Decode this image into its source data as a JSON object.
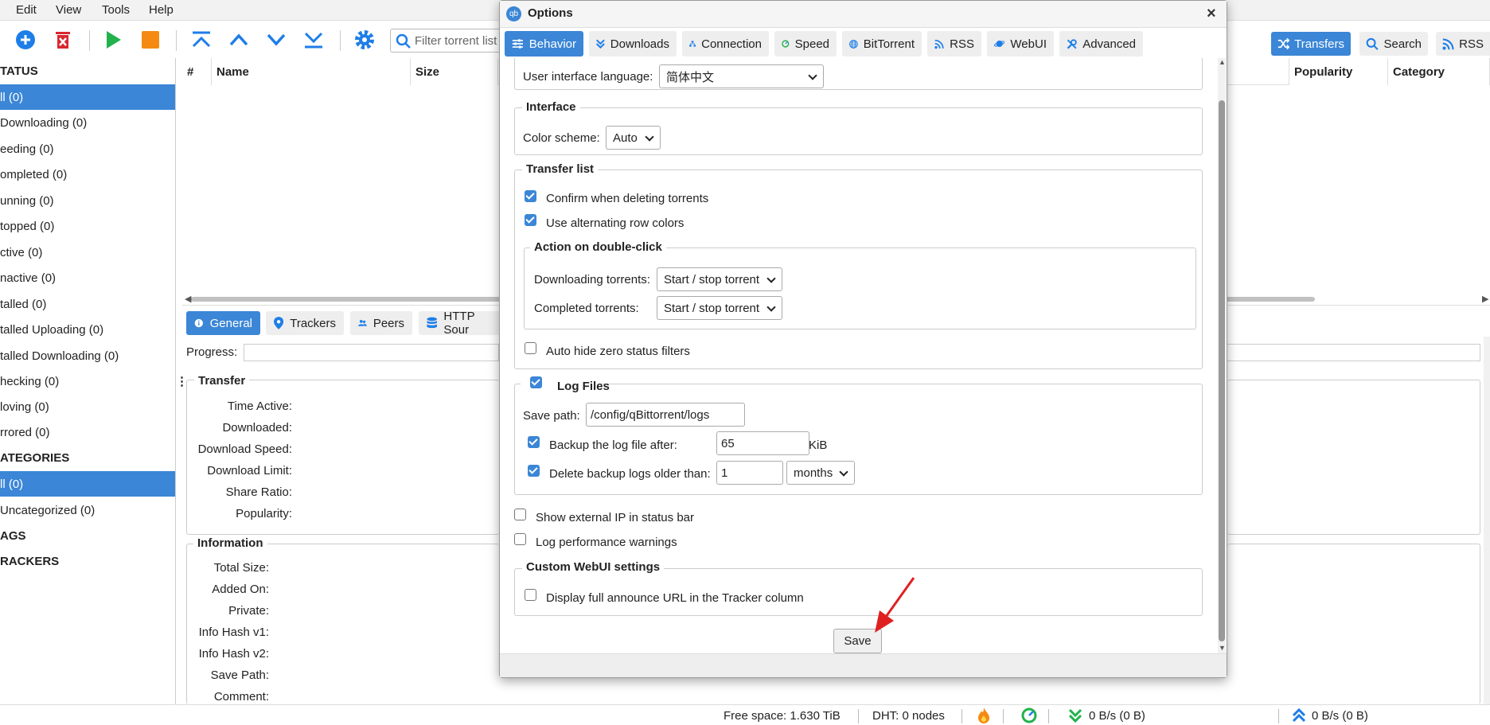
{
  "menu": {
    "items": [
      "Edit",
      "View",
      "Tools",
      "Help"
    ]
  },
  "toolbar": {
    "filter_placeholder": "Filter torrent list...",
    "filter_visible": "Filter torrent list",
    "right_tabs": [
      {
        "label": "Transfers",
        "icon": "shuffle-icon",
        "active": true
      },
      {
        "label": "Search",
        "icon": "search-icon",
        "active": false
      },
      {
        "label": "RSS",
        "icon": "rss-icon",
        "active": false
      }
    ]
  },
  "sidebar": {
    "status_header": "TATUS",
    "status_items": [
      "ll (0)",
      "Downloading (0)",
      "eeding (0)",
      "ompleted (0)",
      "unning (0)",
      "topped (0)",
      "ctive (0)",
      "nactive (0)",
      "talled (0)",
      "talled Uploading (0)",
      "talled Downloading (0)",
      "hecking (0)",
      "loving (0)",
      "rrored (0)"
    ],
    "categories_header": "ATEGORIES",
    "category_items": [
      "ll (0)",
      "Uncategorized (0)"
    ],
    "tags_header": "AGS",
    "trackers_header": "RACKERS"
  },
  "table": {
    "columns_left": [
      "#",
      "Name",
      "Size"
    ],
    "columns_right": [
      "Popularity",
      "Category"
    ]
  },
  "panel": {
    "tabs": [
      {
        "label": "General",
        "icon": "info-icon",
        "active": true
      },
      {
        "label": "Trackers",
        "icon": "location-pin-icon",
        "active": false
      },
      {
        "label": "Peers",
        "icon": "users-icon",
        "active": false
      },
      {
        "label": "HTTP Sour",
        "icon": "database-icon",
        "active": false
      }
    ],
    "progress_label": "Progress:",
    "transfer_legend": "Transfer",
    "transfer_fields": [
      "Time Active:",
      "Downloaded:",
      "Download Speed:",
      "Download Limit:",
      "Share Ratio:",
      "Popularity:"
    ],
    "information_legend": "Information",
    "information_fields": [
      "Total Size:",
      "Added On:",
      "Private:",
      "Info Hash v1:",
      "Info Hash v2:",
      "Save Path:",
      "Comment:"
    ]
  },
  "statusbar": {
    "free_space": "Free space: 1.630 TiB",
    "dht": "DHT: 0 nodes",
    "download": "0 B/s (0 B)",
    "upload": "0 B/s (0 B)"
  },
  "dialog": {
    "title": "Options",
    "app_icon_text": "qb",
    "close_glyph": "×",
    "tabs": [
      {
        "label": "Behavior",
        "icon": "sliders-icon",
        "active": true
      },
      {
        "label": "Downloads",
        "icon": "double-chevron-down-icon",
        "active": false
      },
      {
        "label": "Connection",
        "icon": "network-icon",
        "active": false
      },
      {
        "label": "Speed",
        "icon": "speedometer-icon",
        "active": false
      },
      {
        "label": "BitTorrent",
        "icon": "globe-icon",
        "active": false
      },
      {
        "label": "RSS",
        "icon": "rss-icon",
        "active": false
      },
      {
        "label": "WebUI",
        "icon": "planet-icon",
        "active": false
      },
      {
        "label": "Advanced",
        "icon": "tools-icon",
        "active": false
      }
    ],
    "language": {
      "label": "User interface language:",
      "value": "简体中文"
    },
    "interface": {
      "legend": "Interface",
      "color_label": "Color scheme:",
      "color_value": "Auto"
    },
    "transfer_list": {
      "legend": "Transfer list",
      "confirm_delete": {
        "label": "Confirm when deleting torrents",
        "checked": true
      },
      "alt_rows": {
        "label": "Use alternating row colors",
        "checked": true
      },
      "double_click": {
        "legend": "Action on double-click",
        "downloading_label": "Downloading torrents:",
        "downloading_value": "Start / stop torrent",
        "completed_label": "Completed torrents:",
        "completed_value": "Start / stop torrent"
      },
      "auto_hide": {
        "label": "Auto hide zero status filters",
        "checked": false
      }
    },
    "log_files": {
      "legend": "Log Files",
      "checked": true,
      "save_path_label": "Save path:",
      "save_path_value": "/config/qBittorrent/logs",
      "backup": {
        "label": "Backup the log file after:",
        "checked": true,
        "value": "65",
        "unit": "KiB"
      },
      "delete": {
        "label": "Delete backup logs older than:",
        "checked": true,
        "value": "1",
        "unit": "months"
      }
    },
    "show_external_ip": {
      "label": "Show external IP in status bar",
      "checked": false
    },
    "log_perf": {
      "label": "Log performance warnings",
      "checked": false
    },
    "custom_webui": {
      "legend": "Custom WebUI settings",
      "full_announce": {
        "label": "Display full announce URL in the Tracker column",
        "checked": false
      }
    },
    "save_label": "Save"
  },
  "colors": {
    "accent": "#3b86d6",
    "annotation_arrow": "#e02020"
  }
}
